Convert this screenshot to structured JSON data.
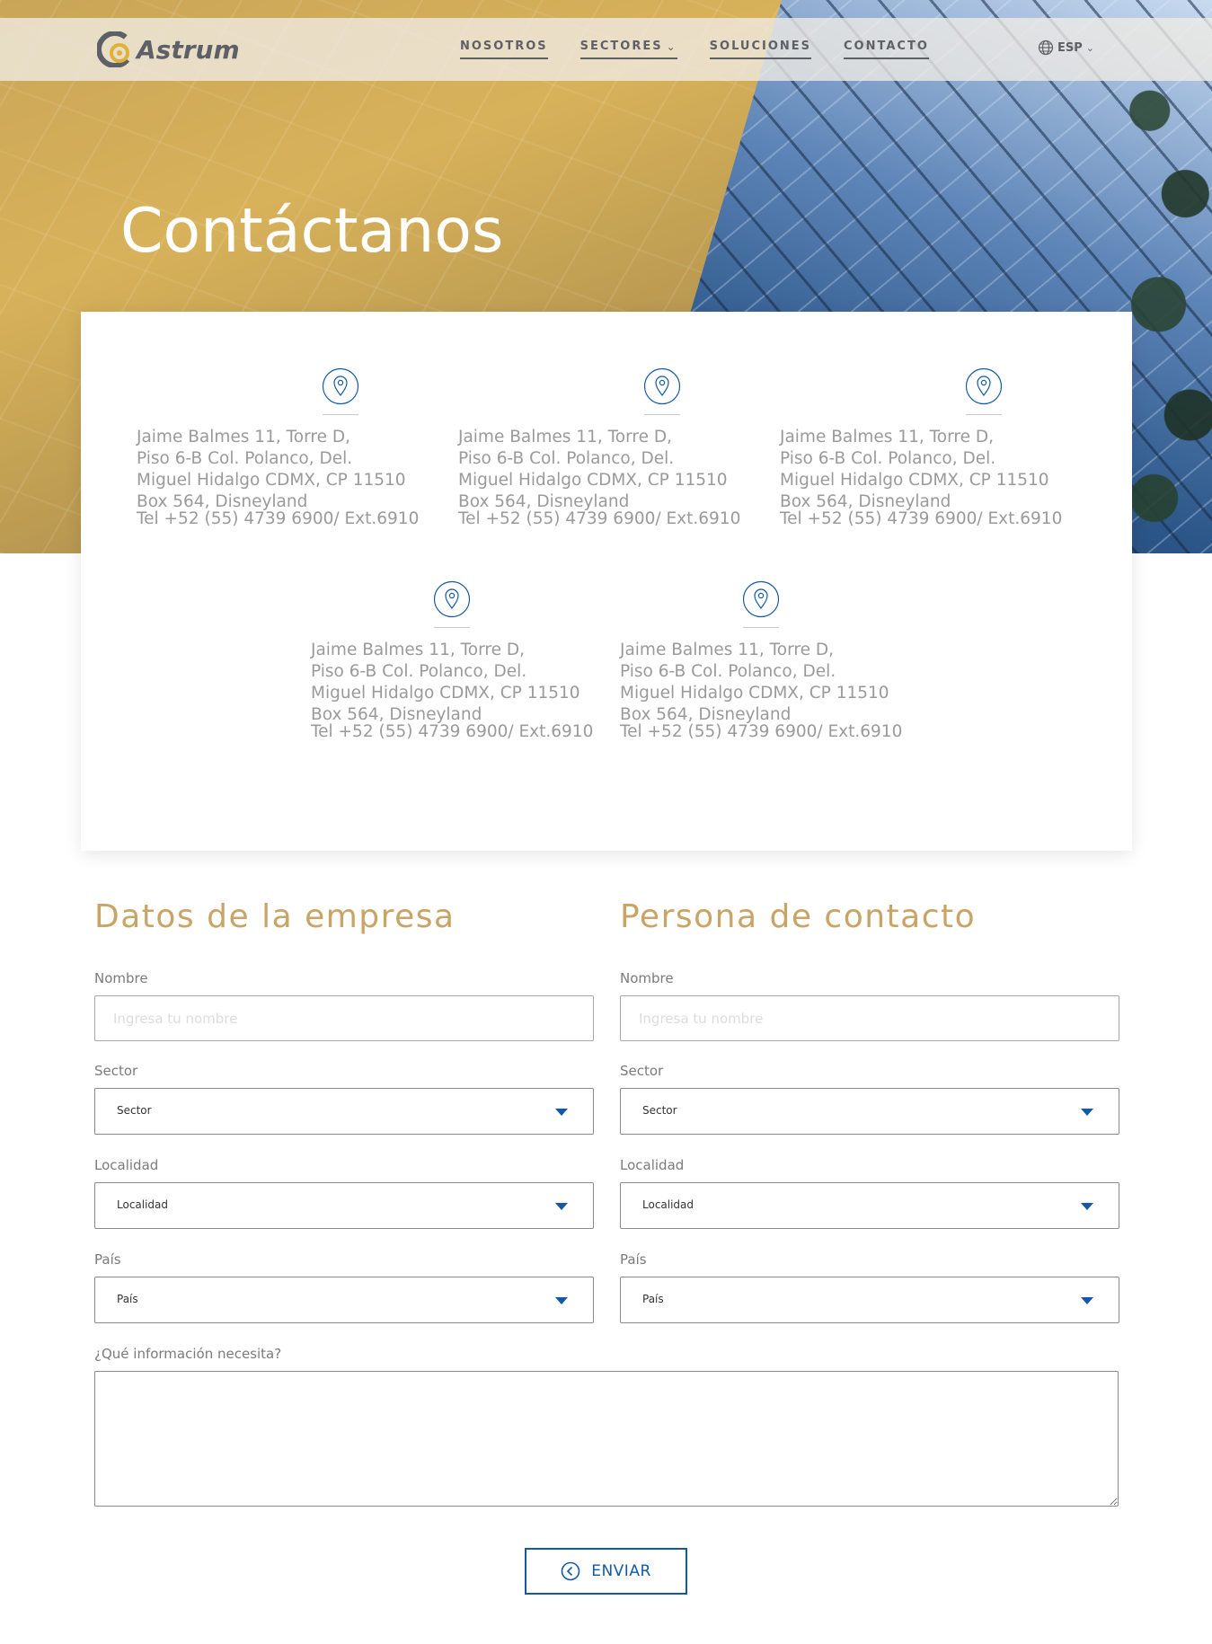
{
  "brand": {
    "name": "Astrum"
  },
  "nav": {
    "items": [
      {
        "label": "NOSOTROS"
      },
      {
        "label": "SECTORES"
      },
      {
        "label": "SOLUCIONES"
      },
      {
        "label": "CONTACTO"
      }
    ],
    "language": "ESP"
  },
  "hero": {
    "title": "Contáctanos"
  },
  "offices": [
    {
      "address": "Jaime Balmes 11, Torre D,\nPiso 6-B Col. Polanco, Del.\nMiguel Hidalgo CDMX, CP 11510\nBox 564, Disneyland",
      "tel": "Tel +52 (55) 4739 6900/ Ext.6910"
    },
    {
      "address": "Jaime Balmes 11, Torre D,\nPiso 6-B Col. Polanco, Del.\nMiguel Hidalgo CDMX, CP 11510\nBox 564, Disneyland",
      "tel": "Tel +52 (55) 4739 6900/ Ext.6910"
    },
    {
      "address": "Jaime Balmes 11, Torre D,\nPiso 6-B Col. Polanco, Del.\nMiguel Hidalgo CDMX, CP 11510\nBox 564, Disneyland",
      "tel": "Tel +52 (55) 4739 6900/ Ext.6910"
    },
    {
      "address": "Jaime Balmes 11, Torre D,\nPiso 6-B Col. Polanco, Del.\nMiguel Hidalgo CDMX, CP 11510\nBox 564, Disneyland",
      "tel": "Tel +52 (55) 4739 6900/ Ext.6910"
    },
    {
      "address": "Jaime Balmes 11, Torre D,\nPiso 6-B Col. Polanco, Del.\nMiguel Hidalgo CDMX, CP 11510\nBox 564, Disneyland",
      "tel": "Tel +52 (55) 4739 6900/ Ext.6910"
    }
  ],
  "company_form": {
    "title": "Datos de la empresa",
    "name_label": "Nombre",
    "name_placeholder": "Ingresa tu nombre",
    "sector_label": "Sector",
    "sector_value": "Sector",
    "locality_label": "Localidad",
    "locality_value": "Localidad",
    "country_label": "País",
    "country_value": "País"
  },
  "contact_form": {
    "title": "Persona de contacto",
    "name_label": "Nombre",
    "name_placeholder": "Ingresa tu nombre",
    "sector_label": "Sector",
    "sector_value": "Sector",
    "locality_label": "Localidad",
    "locality_value": "Localidad",
    "country_label": "País",
    "country_value": "País"
  },
  "message": {
    "label": "¿Qué información necesita?"
  },
  "submit": {
    "label": "ENVIAR"
  },
  "colors": {
    "accent_gold": "#c9a467",
    "accent_blue": "#1459a5",
    "text_gray": "#9a9a9a"
  },
  "icons": {
    "office": "map-pin-icon",
    "submit": "chevron-left-circle-icon",
    "language": "globe-icon"
  }
}
